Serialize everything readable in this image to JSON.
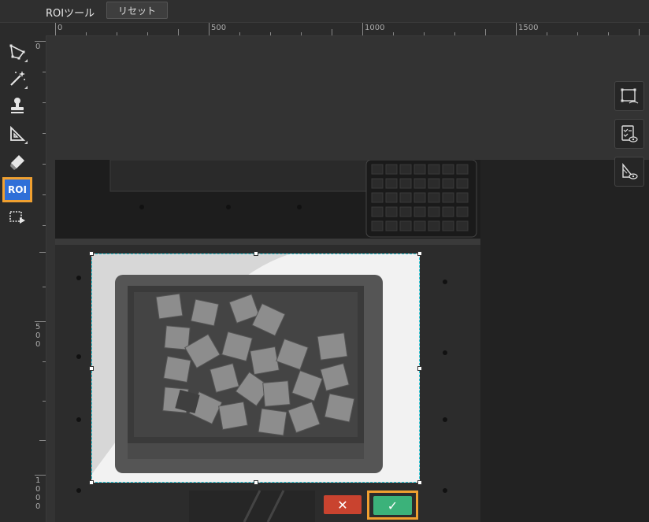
{
  "toolbar": {
    "title": "ROIツール",
    "reset_label": "リセット"
  },
  "left_tools": [
    {
      "name": "polygon-select-tool",
      "icon": "polygon-select-icon"
    },
    {
      "name": "magic-wand-tool",
      "icon": "magic-wand-icon"
    },
    {
      "name": "stamp-tool",
      "icon": "stamp-icon"
    },
    {
      "name": "ruler-tool",
      "icon": "triangle-ruler-icon"
    },
    {
      "name": "eraser-tool",
      "icon": "eraser-icon"
    },
    {
      "name": "roi-tool",
      "icon": "roi-icon",
      "label": "ROI",
      "active": true
    },
    {
      "name": "crop-play-tool",
      "icon": "crop-play-icon"
    }
  ],
  "h_ruler": {
    "labels": [
      "0",
      "500",
      "1000",
      "1500"
    ]
  },
  "v_ruler": {
    "labels": [
      "0",
      "500",
      "1000"
    ]
  },
  "right_panel": [
    {
      "name": "show-roi-toggle",
      "icon": "roi-eye-icon"
    },
    {
      "name": "show-checklist-toggle",
      "icon": "checklist-eye-icon"
    },
    {
      "name": "show-mask-toggle",
      "icon": "mask-eye-icon"
    }
  ],
  "actions": {
    "cancel_symbol": "✕",
    "confirm_symbol": "✓"
  },
  "colors": {
    "accent_orange": "#f0a030",
    "roi_active_blue": "#2f6fd8",
    "roi_outline_cyan": "#2ad0e0",
    "cancel_red": "#c9432f",
    "confirm_green": "#3bb27a"
  }
}
